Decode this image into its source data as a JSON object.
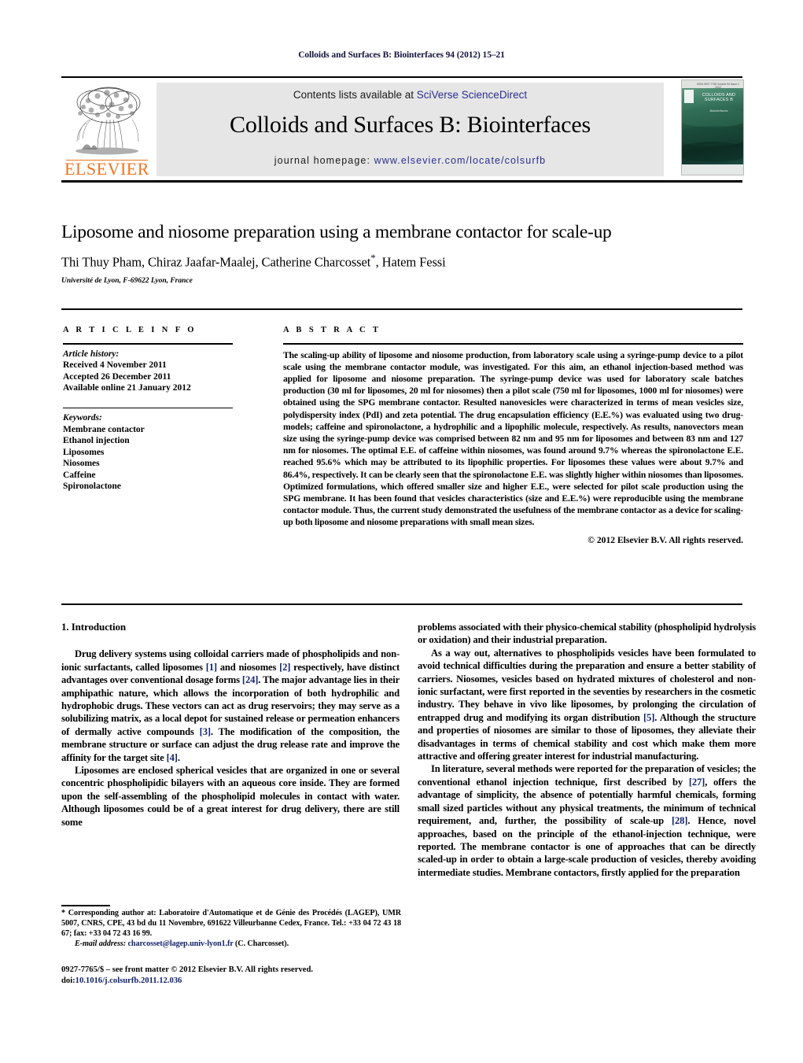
{
  "running_head": "Colloids and Surfaces B: Biointerfaces 94 (2012) 15–21",
  "masthead": {
    "contents_prefix": "Contents lists available at ",
    "contents_link": "SciVerse ScienceDirect",
    "journal_title": "Colloids and Surfaces B: Biointerfaces",
    "homepage_prefix": "journal homepage: ",
    "homepage_url": "www.elsevier.com/locate/colsurfb",
    "publisher_wordmark": "ELSEVIER",
    "cover": {
      "header_line": "ISSN 0927-7765 Volume 94 Issue 1 2012",
      "title": "COLLOIDS AND SURFACES B",
      "subtitle": "Biointerfaces"
    }
  },
  "article": {
    "title": "Liposome and niosome preparation using a membrane contactor for scale-up",
    "authors": "Thi Thuy Pham, Chiraz Jaafar-Maalej, Catherine Charcosset",
    "corresponding_marker": "*",
    "authors_tail": ", Hatem Fessi",
    "affiliation": "Université de Lyon, F-69622 Lyon, France"
  },
  "article_info": {
    "heading": "A R T I C L E   I N F O",
    "history_label": "Article history:",
    "history": [
      "Received 4 November 2011",
      "Accepted 26 December 2011",
      "Available online 21 January 2012"
    ],
    "keywords_label": "Keywords:",
    "keywords": [
      "Membrane contactor",
      "Ethanol injection",
      "Liposomes",
      "Niosomes",
      "Caffeine",
      "Spironolactone"
    ]
  },
  "abstract": {
    "heading": "A B S T R A C T",
    "text": "The scaling-up ability of liposome and niosome production, from laboratory scale using a syringe-pump device to a pilot scale using the membrane contactor module, was investigated. For this aim, an ethanol injection-based method was applied for liposome and niosome preparation. The syringe-pump device was used for laboratory scale batches production (30 ml for liposomes, 20 ml for niosomes) then a pilot scale (750 ml for liposomes, 1000 ml for niosomes) were obtained using the SPG membrane contactor. Resulted nanovesicles were characterized in terms of mean vesicles size, polydispersity index (PdI) and zeta potential. The drug encapsulation efficiency (E.E.%) was evaluated using two drug-models; caffeine and spironolactone, a hydrophilic and a lipophilic molecule, respectively. As results, nanovectors mean size using the syringe-pump device was comprised between 82 nm and 95 nm for liposomes and between 83 nm and 127 nm for niosomes. The optimal E.E. of caffeine within niosomes, was found around 9.7% whereas the spironolactone E.E. reached 95.6% which may be attributed to its lipophilic properties. For liposomes these values were about 9.7% and 86.4%, respectively. It can be clearly seen that the spironolactone E.E. was slightly higher within niosomes than liposomes. Optimized formulations, which offered smaller size and higher E.E., were selected for pilot scale production using the SPG membrane. It has been found that vesicles characteristics (size and E.E.%) were reproducible using the membrane contactor module. Thus, the current study demonstrated the usefulness of the membrane contactor as a device for scaling-up both liposome and niosome preparations with small mean sizes.",
    "copyright": "© 2012 Elsevier B.V. All rights reserved."
  },
  "body": {
    "section_heading": "1.  Introduction",
    "left_paragraphs": [
      "Drug delivery systems using colloidal carriers made of phospholipids and non-ionic surfactants, called liposomes [1] and niosomes [2] respectively, have distinct advantages over conventional dosage forms [24]. The major advantage lies in their amphipathic nature, which allows the incorporation of both hydrophilic and hydrophobic drugs. These vectors can act as drug reservoirs; they may serve as a solubilizing matrix, as a local depot for sustained release or permeation enhancers of dermally active compounds [3]. The modification of the composition, the membrane structure or surface can adjust the drug release rate and improve the affinity for the target site [4].",
      "Liposomes are enclosed spherical vesicles that are organized in one or several concentric phospholipidic bilayers with an aqueous core inside. They are formed upon the self-assembling of the phospholipid molecules in contact with water. Although liposomes could be of a great interest for drug delivery, there are still some"
    ],
    "right_paragraphs": [
      "problems associated with their physico-chemical stability (phospholipid hydrolysis or oxidation) and their industrial preparation.",
      "As a way out, alternatives to phospholipids vesicles have been formulated to avoid technical difficulties during the preparation and ensure a better stability of carriers. Niosomes, vesicles based on hydrated mixtures of cholesterol and non-ionic surfactant, were first reported in the seventies by researchers in the cosmetic industry. They behave in vivo like liposomes, by prolonging the circulation of entrapped drug and modifying its organ distribution [5]. Although the structure and properties of niosomes are similar to those of liposomes, they alleviate their disadvantages in terms of chemical stability and cost which make them more attractive and offering greater interest for industrial manufacturing.",
      "In literature, several methods were reported for the preparation of vesicles; the conventional ethanol injection technique, first described by [27], offers the advantage of simplicity, the absence of potentially harmful chemicals, forming small sized particles without any physical treatments, the minimum of technical requirement, and, further, the possibility of scale-up [28]. Hence, novel approaches, based on the principle of the ethanol-injection technique, were reported. The membrane contactor is one of approaches that can be directly scaled-up in order to obtain a large-scale production of vesicles, thereby avoiding intermediate studies. Membrane contactors, firstly applied for the preparation"
    ]
  },
  "footnote": {
    "corresponding": "* Corresponding author at: Laboratoire d'Automatique et de Génie des Procédés (LAGEP), UMR 5007, CNRS, CPE, 43 bd du 11 Novembre, 691622 Villeurbanne Cedex, France. Tel.: +33 04 72 43 18 67; fax: +33 04 72 43 16 99.",
    "email_label": "E-mail address:",
    "email": "charcosset@lagep.univ-lyon1.fr",
    "email_suffix": " (C. Charcosset)."
  },
  "imprint": {
    "issn_line": "0927-7765/$ – see front matter © 2012 Elsevier B.V. All rights reserved.",
    "doi_label": "doi:",
    "doi_value": "10.1016/j.colsurfb.2011.12.036"
  },
  "colors": {
    "link": "#2b2f8f",
    "reference": "#12236b",
    "elsevier_orange": "#E87722",
    "masthead_bg": "#e6e6e6"
  }
}
